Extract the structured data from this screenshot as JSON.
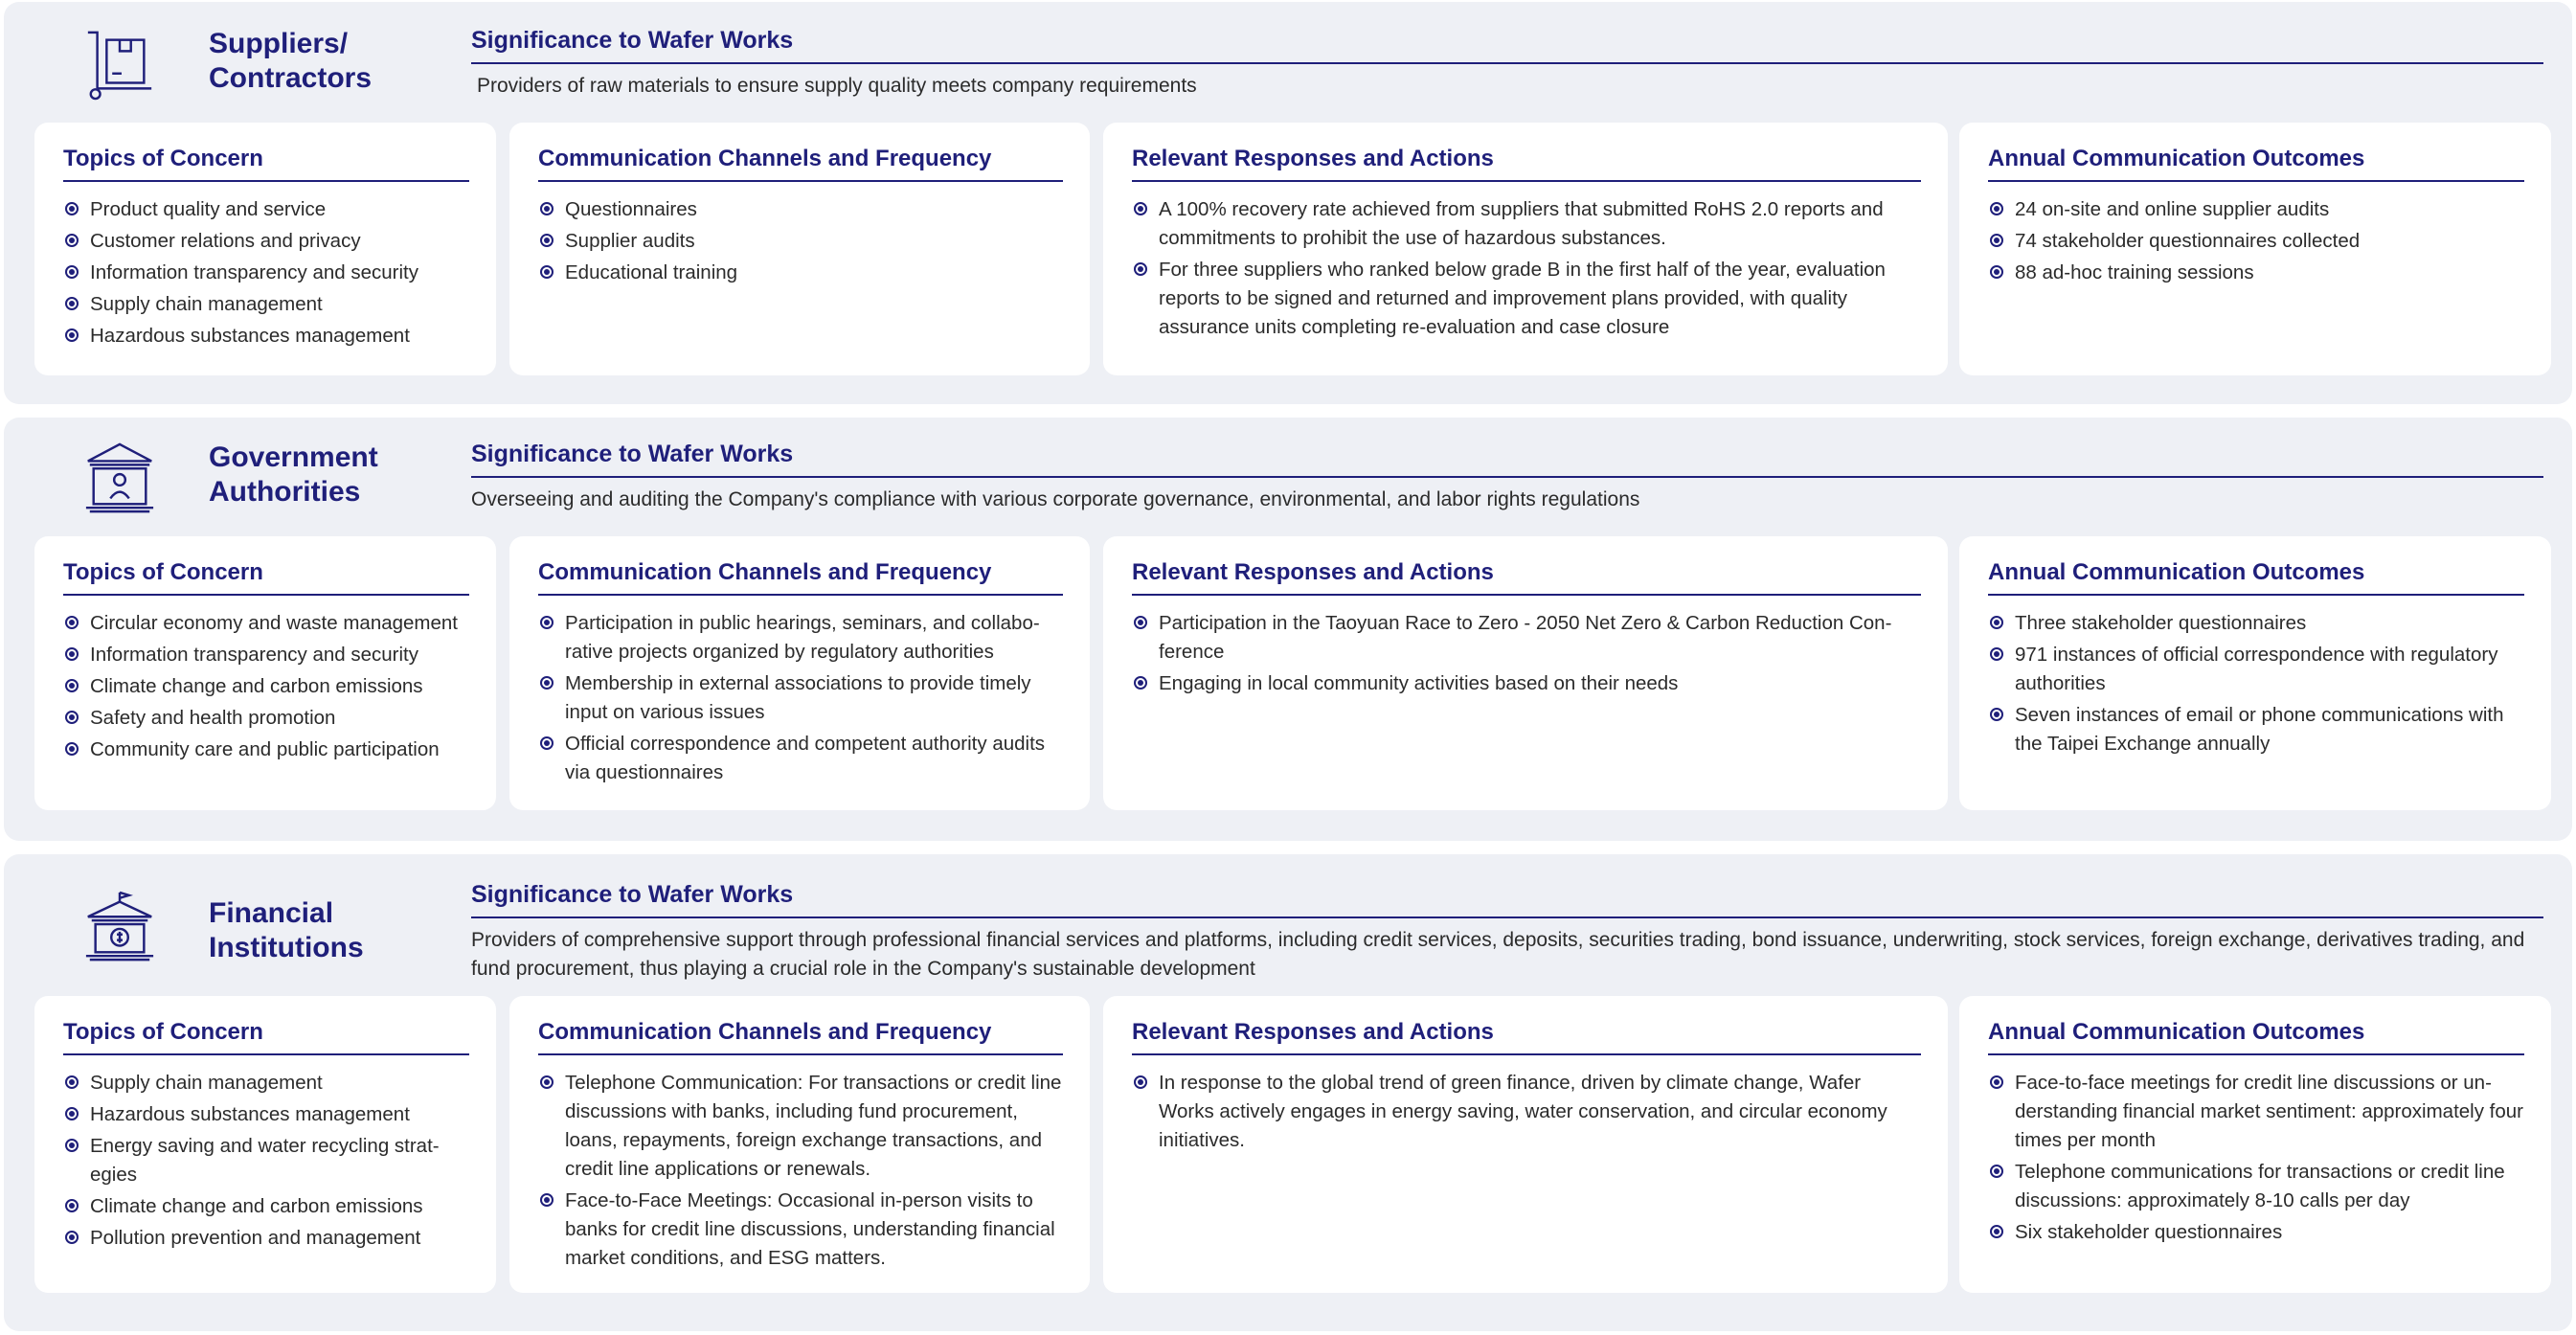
{
  "sections": [
    {
      "stakeholder": "Suppliers/ Contractors",
      "icon": "hand-truck-icon",
      "significance_heading": "Significance to Wafer Works",
      "significance": "Providers of raw materials to ensure supply quality meets company requirements",
      "topics_heading": "Topics of Concern",
      "topics": [
        "Product quality and service",
        "Customer relations and privacy",
        "Information transparency and security",
        "Supply chain management",
        "Hazardous substances management"
      ],
      "channels_heading": "Communication Channels and Frequency",
      "channels": [
        "Questionnaires",
        "Supplier audits",
        "Educational training"
      ],
      "responses_heading": "Relevant Responses and Actions",
      "responses": [
        "A 100% recovery rate achieved from suppliers that submitted RoHS 2.0 reports and commitments to prohibit the use of hazardous substances.",
        "For three suppliers who ranked below grade B in the first half of the year, evalu­ation reports to be signed and returned and improvement plans provided, with quality assurance units completing re-evaluation and case closure"
      ],
      "outcomes_heading": "Annual Communication Outcomes",
      "outcomes": [
        "24 on-site and online supplier audits",
        "74 stakeholder questionnaires collected",
        "88 ad-hoc training sessions"
      ]
    },
    {
      "stakeholder": "Government Authorities",
      "icon": "government-building-icon",
      "significance_heading": "Significance to Wafer Works",
      "significance": "Overseeing and auditing the Company's compliance with various corporate governance, environmental, and labor rights regulations",
      "topics_heading": "Topics of Concern",
      "topics": [
        "Circular economy and waste management",
        "Information transparency and security",
        "Climate change and carbon emissions",
        "Safety and health promotion",
        "Community care and public participation"
      ],
      "channels_heading": "Communication Channels and Frequency",
      "channels": [
        "Participation in public hearings, seminars, and collabo­rative projects organized by regulatory authorities",
        "Membership in external associations to provide timely input on various issues",
        "Official correspondence and competent authority au­dits via questionnaires"
      ],
      "responses_heading": "Relevant Responses and Actions",
      "responses": [
        "Participation in the Taoyuan Race to Zero - 2050 Net Zero & Carbon Reduction Con­ference",
        "Engaging in local community activities based on their needs"
      ],
      "outcomes_heading": "Annual Communication Outcomes",
      "outcomes": [
        "Three stakeholder questionnaires",
        "971 instances of official correspondence with regulatory authorities",
        "Seven instances of email or phone communications with the Taipei Exchange annually"
      ]
    },
    {
      "stakeholder": "Financial Institutions",
      "icon": "bank-icon",
      "significance_heading": "Significance to Wafer Works",
      "significance": "Providers of comprehensive support through professional financial services and platforms, including credit services, deposits, securities trading, bond issuance, underwriting, stock services, foreign exchange, derivatives trading, and fund procurement, thus playing a crucial role in the Company's sustainable development",
      "topics_heading": "Topics of Concern",
      "topics": [
        "Supply chain management",
        "Hazardous substances management",
        "Energy saving and water recycling strat­egies",
        "Climate change and carbon emissions",
        "Pollution prevention and management"
      ],
      "channels_heading": "Communication Channels and Frequency",
      "channels": [
        "Telephone Communication: For transactions or credit line discussions with banks, including fund procure­ment, loans, repayments, foreign exchange transactions, and credit line applications or renewals.",
        "Face-to-Face Meetings: Occasional in-person visits to banks for credit line discussions, understanding finan­cial market conditions, and ESG matters."
      ],
      "responses_heading": "Relevant Responses and Actions",
      "responses": [
        "In response to the global trend of green finance, driven by climate change, Wafer Works actively engages in energy saving, water conservation, and circular economy initiatives."
      ],
      "outcomes_heading": "Annual Communication Outcomes",
      "outcomes": [
        "Face-to-face meetings for credit line discussions or un­derstanding financial market sentiment: approximately four times per month",
        "Telephone communications for transactions or credit line discussions: approximately 8-10 calls per day",
        "Six stakeholder questionnaires"
      ]
    }
  ]
}
